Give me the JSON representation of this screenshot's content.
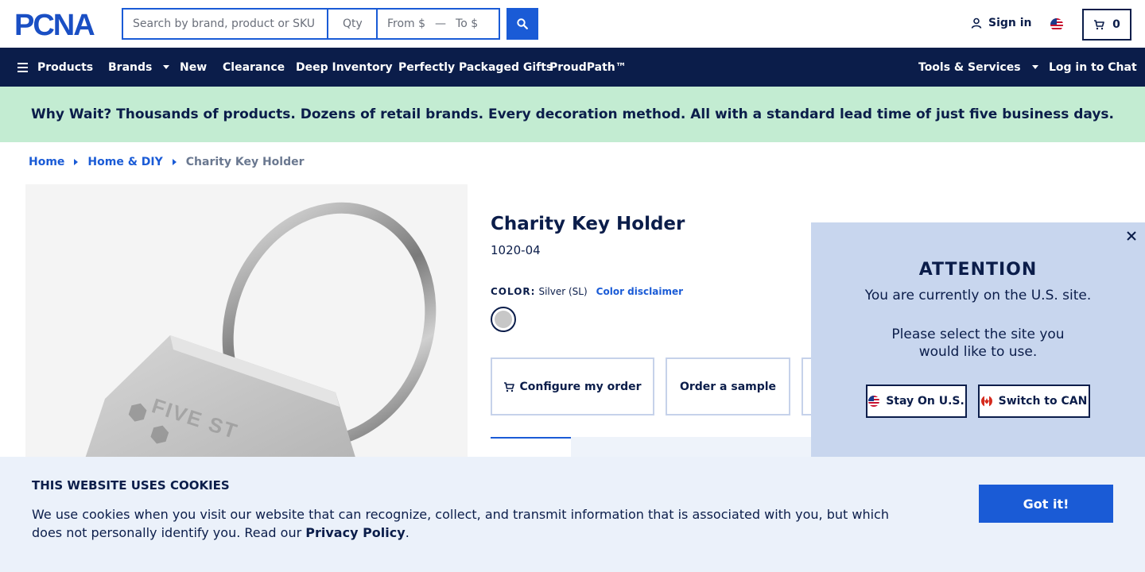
{
  "header": {
    "logo_text": "PCNA",
    "search": {
      "placeholder": "Search by brand, product or SKU",
      "value": ""
    },
    "qty": {
      "placeholder": "Qty"
    },
    "price_from": "From $",
    "price_to": "To $",
    "signin_label": "Sign in",
    "cart_count": "0"
  },
  "nav": {
    "products": "Products",
    "brands": "Brands",
    "new": "New",
    "clearance": "Clearance",
    "deep_inventory": "Deep Inventory",
    "packaged_gifts": "Perfectly Packaged Gifts",
    "proudpath": "ProudPath™",
    "tools": "Tools & Services",
    "chat": "Log in to Chat"
  },
  "promo": "Why Wait? Thousands of products. Dozens of retail brands. Every decoration method. All with a standard lead time of just five business days.",
  "breadcrumb": [
    "Home",
    "Home & DIY",
    "Charity Key Holder"
  ],
  "product": {
    "title": "Charity Key Holder",
    "sku": "1020-04",
    "color_label": "COLOR:",
    "color_value": "Silver (SL)",
    "color_disclaimer": "Color disclaimer",
    "configure_label": "Configure my order",
    "sample_label": "Order a sample",
    "swatch_color": "#c7c7c7",
    "engraving_text": "FIVE ST"
  },
  "site_popup": {
    "heading": "ATTENTION",
    "line1": "You are currently on the U.S. site.",
    "line2": "Please select the site you",
    "line3": "would like to use.",
    "stay_label": "Stay On U.S.",
    "switch_label": "Switch to CAN"
  },
  "cookie": {
    "title": "THIS WEBSITE USES COOKIES",
    "text_before": "We use cookies when you visit our website that can recognize, collect, and transmit information that is associated with you, but which does not personally identify you. Read our ",
    "policy_link": "Privacy Policy",
    "text_after": ".",
    "button": "Got it!"
  },
  "colors": {
    "navy": "#0b1d4a",
    "accent_blue": "#1a5bd6",
    "promo_green": "#c3ecd2",
    "popup_bg": "#c8d6ee",
    "cookie_bg": "#ebf1fa"
  }
}
